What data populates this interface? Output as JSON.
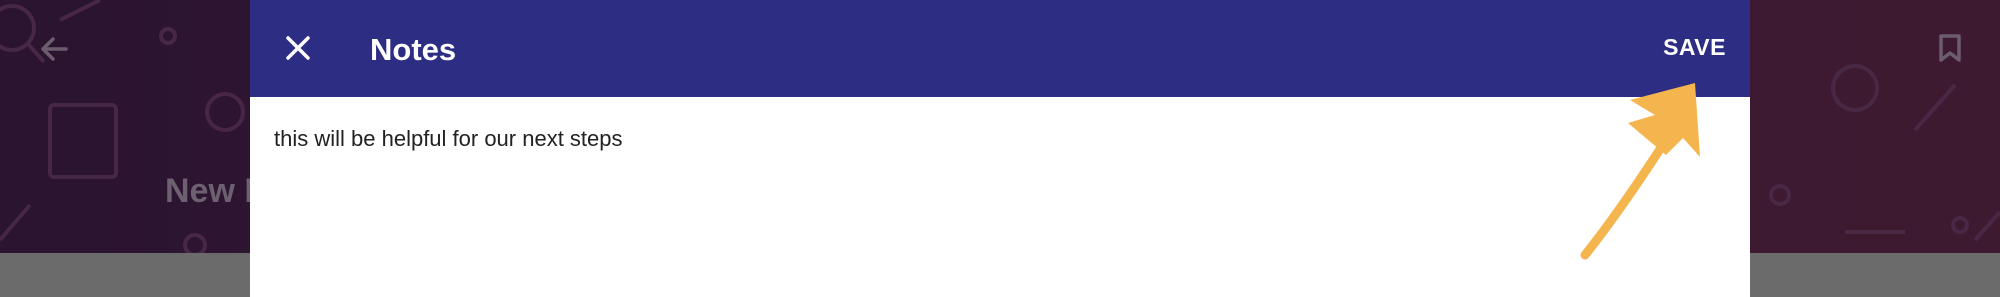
{
  "background": {
    "title_partial": "New H"
  },
  "dialog": {
    "title": "Notes",
    "save_label": "SAVE",
    "note_value": "this will be helpful for our next steps"
  },
  "colors": {
    "header": "#2e2d84",
    "annotation_arrow": "#f5b54e"
  },
  "icons": {
    "close": "close-icon",
    "back": "back-arrow-icon",
    "bookmark": "bookmark-icon"
  }
}
